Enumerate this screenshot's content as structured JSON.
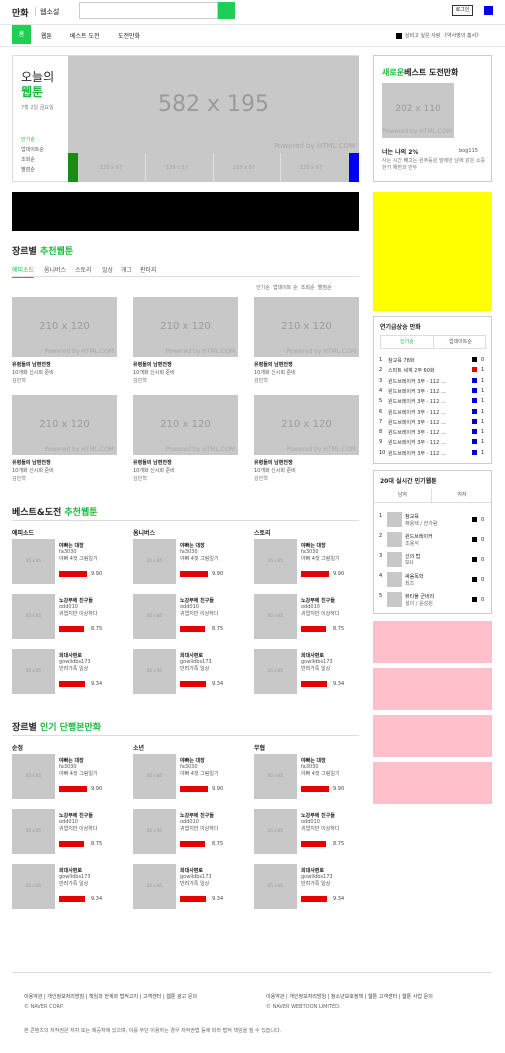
{
  "header": {
    "logo": "만화",
    "service": "웹소설",
    "login": "로그인"
  },
  "nav": {
    "home": "홈",
    "items": [
      "웹툰",
      "베스트 도전",
      "도전만화"
    ],
    "notice": "상비고 싶은 사랑 《약사영의 흠서》"
  },
  "today": {
    "title1": "오늘의",
    "title2": "웹툰",
    "date": "7월 2일 금요일",
    "banner": "582 x 195",
    "watermark": "Powered by HTML.COM",
    "filters": [
      "인기순",
      "업데이트순",
      "조회순",
      "별점순"
    ],
    "thumb": "125 x 57"
  },
  "new_best": {
    "title_green": "새로운",
    "title_black": "베스트 도전만화",
    "thumb": "202 x 110",
    "watermark": "Powered by HTML.COM",
    "name": "너는 나의 2%",
    "author": "bog115",
    "desc": "사는 시간 빼고는 원주등원 말에만 남에 같은 소중한가 해변과 만두"
  },
  "genre": {
    "title_black": "장르별 ",
    "title_green": "추천웹툰",
    "tabs": [
      "에피소드",
      "옴니버스",
      "스토리",
      "일상",
      "개그",
      "판타지"
    ],
    "sorts": [
      "인기순",
      "업데이트 순",
      "조회순",
      "별점순"
    ],
    "thumb": "210 x 120",
    "watermark": "Powered by HTML.COM",
    "item_title": "유령들의 남편전쟁",
    "item_sub": "10개화 신시회 준비",
    "item_author": "김민혁"
  },
  "best": {
    "title_black": "베스트&도전 ",
    "title_green": "추천웹툰",
    "columns": [
      "에피소드",
      "옴니버스",
      "스토리"
    ],
    "thumb": "85 x 85",
    "items": [
      {
        "title": "야빠는 대장",
        "author": "fa3030",
        "desc": "야빠 4컷 그림일기",
        "score": "9.90",
        "fill": 0.92
      },
      {
        "title": "노강부에 친구들",
        "author": "odd010",
        "desc": "귀엽지만 이상하다",
        "score": "8.75",
        "fill": 0.82
      },
      {
        "title": "희대사편로",
        "author": "gowlldbs173",
        "desc": "반려가족 일상",
        "score": "9.34",
        "fill": 0.86
      }
    ]
  },
  "popular": {
    "title_black": "장르별 ",
    "title_green": "인기 단행본만화",
    "columns": [
      "순정",
      "소년",
      "무협"
    ]
  },
  "rising": {
    "title": "연기급상승 만화",
    "tabs": [
      "인기순",
      "업데이트순"
    ],
    "items": [
      {
        "rank": "1",
        "name": "참교육 78화",
        "color": "#000000",
        "val": "0"
      },
      {
        "rank": "2",
        "name": "스마트 세계 2부 60화",
        "color": "#e60000",
        "val": "1"
      },
      {
        "rank": "3",
        "name": "윈드브레이커 3부 · 112 ...",
        "color": "#0000cc",
        "val": "1"
      },
      {
        "rank": "4",
        "name": "윈드브레이커 3부 · 112 ...",
        "color": "#0000cc",
        "val": "1"
      },
      {
        "rank": "5",
        "name": "윈드브레이커 3부 · 112 ...",
        "color": "#0000cc",
        "val": "1"
      },
      {
        "rank": "6",
        "name": "윈드브레이커 3부 · 112 ...",
        "color": "#0000cc",
        "val": "1"
      },
      {
        "rank": "7",
        "name": "윈드브레이커 3부 · 112 ...",
        "color": "#0000cc",
        "val": "1"
      },
      {
        "rank": "8",
        "name": "윈드브레이커 3부 · 112 ...",
        "color": "#0000cc",
        "val": "1"
      },
      {
        "rank": "9",
        "name": "윈드브레이커 3부 · 112 ...",
        "color": "#0000cc",
        "val": "1"
      },
      {
        "rank": "10",
        "name": "윈드브레이커 3부 · 112 ...",
        "color": "#0000cc",
        "val": "1"
      }
    ]
  },
  "realtime": {
    "title": "20대 실시간 인기웹툰",
    "tabs": [
      "남자",
      "여자"
    ],
    "items": [
      {
        "rank": "1",
        "t1": "참교육",
        "t2": "채용택 / 한가람",
        "val": "0"
      },
      {
        "rank": "2",
        "t1": "윈드브레이커",
        "t2": "조용석",
        "val": "0"
      },
      {
        "rank": "3",
        "t1": "신의 탑",
        "t2": "SIU",
        "val": "0"
      },
      {
        "rank": "4",
        "t1": "싸움독학",
        "t2": "최츠",
        "val": "0"
      },
      {
        "rank": "5",
        "t1": "뷰티풀 군바리",
        "t2": "설이 / 윤성원",
        "val": "0"
      }
    ]
  },
  "footer": {
    "links_left": "이용약관 | 개인정보처리방침 | 책임과 한계와 법적고지 | 고객센터 | 웹툰 광고 문의",
    "links_right": "이용약관 | 개인정보처리방침 | 청소년보호정책 | 웹툰 고객센터 | 웹툰 사업 문의",
    "copy_left": "© NAVER CORP.",
    "copy_right": "© NAVER WEBTOON LIMITED.",
    "notice": "본 콘텐츠의 저작권은 저자 또는 제공처에 있으며, 이를 무단 이용하는 경우 저작권법 등에 따라 법적 책임을 질 수 있습니다."
  }
}
